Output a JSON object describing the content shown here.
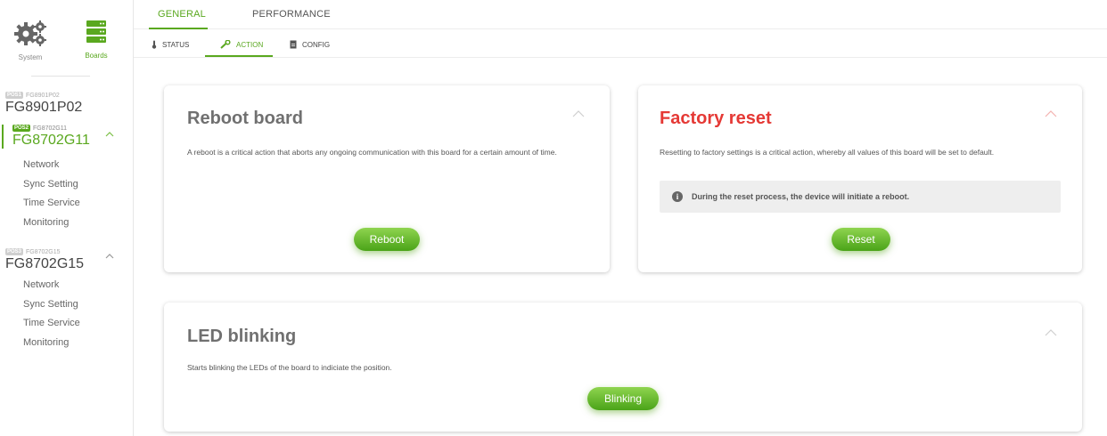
{
  "sidebar": {
    "system_label": "System",
    "boards_label": "Boards",
    "boards": [
      {
        "pos": "POS1",
        "small_id": "FG8901P02",
        "name": "FG8901P02",
        "items": []
      },
      {
        "pos": "POS2",
        "small_id": "FG8702G11",
        "name": "FG8702G11",
        "items": [
          "Network",
          "Sync Setting",
          "Time Service",
          "Monitoring"
        ]
      },
      {
        "pos": "POS3",
        "small_id": "FG8702G15",
        "name": "FG8702G15",
        "items": [
          "Network",
          "Sync Setting",
          "Time Service",
          "Monitoring"
        ]
      }
    ]
  },
  "tabs": {
    "general": "GENERAL",
    "performance": "PERFORMANCE"
  },
  "subtabs": {
    "status": "STATUS",
    "action": "ACTION",
    "config": "CONFIG"
  },
  "cards": {
    "reboot": {
      "title": "Reboot board",
      "description": "A reboot is a critical action that aborts any ongoing communication with this board for a certain amount of time.",
      "button": "Reboot"
    },
    "reset": {
      "title": "Factory reset",
      "description": "Resetting to factory settings is a critical action, whereby all values of this board will be set to default.",
      "note": "During the reset process, the device will initiate a reboot.",
      "button": "Reset"
    },
    "led": {
      "title": "LED blinking",
      "description": "Starts blinking the LEDs of the board to indiciate the position.",
      "button": "Blinking"
    }
  },
  "colors": {
    "accent": "#5aa81f",
    "danger": "#e53935"
  }
}
